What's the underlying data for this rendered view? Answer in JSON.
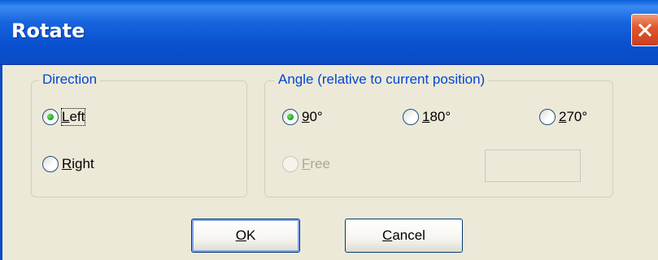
{
  "dialog": {
    "title": "Rotate",
    "close_icon": "close-icon"
  },
  "direction_group": {
    "legend": "Direction",
    "options": [
      {
        "label_prefix": "",
        "label_mnemonic": "L",
        "label_rest": "eft",
        "selected": true,
        "enabled": true
      },
      {
        "label_prefix": "",
        "label_mnemonic": "R",
        "label_rest": "ight",
        "selected": false,
        "enabled": true
      }
    ]
  },
  "angle_group": {
    "legend": "Angle (relative to current position)",
    "options": [
      {
        "label_prefix": "",
        "label_mnemonic": "9",
        "label_rest": "0°",
        "selected": true,
        "enabled": true
      },
      {
        "label_prefix": "",
        "label_mnemonic": "1",
        "label_rest": "80°",
        "selected": false,
        "enabled": true
      },
      {
        "label_prefix": "",
        "label_mnemonic": "2",
        "label_rest": "70°",
        "selected": false,
        "enabled": true
      },
      {
        "label_prefix": "",
        "label_mnemonic": "F",
        "label_rest": "ree",
        "selected": false,
        "enabled": false
      }
    ],
    "free_value": ""
  },
  "buttons": {
    "ok_mnemonic": "O",
    "ok_rest": "K",
    "cancel_mnemonic": "C",
    "cancel_rest": "ancel"
  },
  "colors": {
    "title_bar": "#0a50cf",
    "legend_text": "#0046d5",
    "dialog_bg": "#ece9d8",
    "close_button": "#e0582f"
  }
}
